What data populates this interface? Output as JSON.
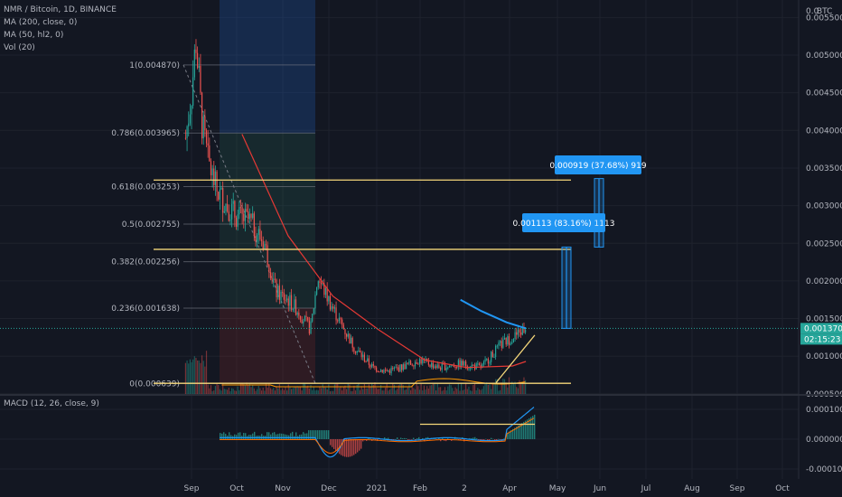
{
  "legend": {
    "title": "NMR / Bitcoin, 1D, BINANCE",
    "ma200": "MA (200, close, 0)",
    "ma50": "MA (50, hl2, 0)",
    "vol": "Vol (20)",
    "macd": "MACD (12, 26, close, 9)"
  },
  "axis": {
    "currency_label": "BTC",
    "top_tick_partial": "0.0",
    "last_price": "0.001370",
    "countdown": "02:15:23"
  },
  "colors": {
    "background": "#131722",
    "up": "#26a69a",
    "down": "#ef5350",
    "ma200": "#e53935",
    "ma50": "#2196f3",
    "macd": "#2196f3",
    "signal": "#ff6d00",
    "volume_ma": "#ff9800",
    "hline": "#f5d77a",
    "measure": "#2196f3"
  },
  "fib_levels": [
    {
      "label": "1(0.004870)",
      "ratio": 1,
      "value": 0.00487
    },
    {
      "label": "0.786(0.003965)",
      "ratio": 0.786,
      "value": 0.003965
    },
    {
      "label": "0.618(0.003253)",
      "ratio": 0.618,
      "value": 0.003253
    },
    {
      "label": "0.5(0.002755)",
      "ratio": 0.5,
      "value": 0.002755
    },
    {
      "label": "0.382(0.002256)",
      "ratio": 0.382,
      "value": 0.002256
    },
    {
      "label": "0.236(0.001638)",
      "ratio": 0.236,
      "value": 0.001638
    },
    {
      "label": "0(0.000639)",
      "ratio": 0,
      "value": 0.000639
    }
  ],
  "measurements": [
    {
      "label": "0.001113 (83.16%) 1113",
      "from": 0.00137,
      "to": 0.00245
    },
    {
      "label": "0.000919 (37.68%) 919",
      "from": 0.00245,
      "to": 0.00336
    }
  ],
  "horizontal_levels": [
    0.00334,
    0.00242,
    0.00064
  ],
  "chart_data": {
    "type": "line",
    "title": "NMR / Bitcoin, 1D, BINANCE",
    "xlabel": "",
    "ylabel": "",
    "x_ticks": [
      "Sep",
      "Oct",
      "Nov",
      "Dec",
      "2021",
      "Feb",
      "2",
      "Apr",
      "May",
      "Jun",
      "Jul",
      "Aug",
      "Sep",
      "Oct"
    ],
    "price_ticks": [
      "0.005500",
      "0.005000",
      "0.004500",
      "0.004000",
      "0.003500",
      "0.003000",
      "0.002500",
      "0.002000",
      "0.001500",
      "0.001000",
      "0.000500"
    ],
    "macd_ticks": [
      "0.000100",
      "0.000000",
      "-0.000100"
    ],
    "ylim": [
      0.0002,
      0.0059
    ],
    "series": [
      {
        "name": "MA (200, close, 0)",
        "x": [
          "Oct 5",
          "Nov 5",
          "Dec 5",
          "Jan 5",
          "Feb 5",
          "Mar 5",
          "Apr 5",
          "Apr 14"
        ],
        "values": [
          0.00395,
          0.0026,
          0.0018,
          0.00135,
          0.00095,
          0.00085,
          0.00087,
          0.00093
        ]
      },
      {
        "name": "MA (50, hl2, 0)",
        "x": [
          "Mar 1",
          "Mar 15",
          "Apr 1",
          "Apr 14"
        ],
        "values": [
          0.00175,
          0.0016,
          0.00145,
          0.00137
        ]
      }
    ],
    "price_path": [
      [
        "2020-08-28",
        0.0039
      ],
      [
        "2020-09-01",
        0.0045
      ],
      [
        "2020-09-04",
        0.0052
      ],
      [
        "2020-09-08",
        0.0041
      ],
      [
        "2020-09-12",
        0.0036
      ],
      [
        "2020-09-18",
        0.0032
      ],
      [
        "2020-09-25",
        0.003
      ],
      [
        "2020-10-02",
        0.00285
      ],
      [
        "2020-10-10",
        0.0028
      ],
      [
        "2020-10-20",
        0.0025
      ],
      [
        "2020-10-28",
        0.00185
      ],
      [
        "2020-11-05",
        0.00175
      ],
      [
        "2020-11-12",
        0.0016
      ],
      [
        "2020-11-20",
        0.00135
      ],
      [
        "2020-11-25",
        0.00205
      ],
      [
        "2020-12-01",
        0.0018
      ],
      [
        "2020-12-10",
        0.00145
      ],
      [
        "2020-12-20",
        0.0011
      ],
      [
        "2021-01-01",
        0.00085
      ],
      [
        "2021-01-10",
        0.0008
      ],
      [
        "2021-01-20",
        0.00085
      ],
      [
        "2021-02-01",
        0.00095
      ],
      [
        "2021-02-15",
        0.00085
      ],
      [
        "2021-03-01",
        0.0009
      ],
      [
        "2021-03-15",
        0.00085
      ],
      [
        "2021-03-28",
        0.00115
      ],
      [
        "2021-04-05",
        0.00125
      ],
      [
        "2021-04-14",
        0.00137
      ]
    ]
  }
}
